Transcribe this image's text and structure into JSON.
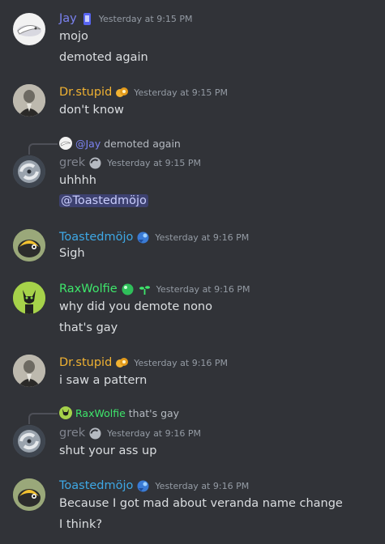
{
  "messages": [
    {
      "user": "Jay",
      "color": "#7b82f0",
      "time": "Yesterday at 9:15 PM",
      "lines": [
        "mojo",
        "demoted again"
      ]
    },
    {
      "user": "Dr.stupid",
      "color": "#f0b232",
      "time": "Yesterday at 9:15 PM",
      "lines": [
        "don't know"
      ]
    },
    {
      "user": "grek",
      "color": "#80848e",
      "time": "Yesterday at 9:15 PM",
      "reply_user": "@Jay",
      "reply_text": "demoted again",
      "reply_color": "#7b82f0",
      "lines": [
        "uhhhh"
      ],
      "mention": "@Toastedmöjo"
    },
    {
      "user": "Toastedmöjo",
      "color": "#3ea8e5",
      "time": "Yesterday at 9:16 PM",
      "lines": [
        "Sigh"
      ]
    },
    {
      "user": "RaxWolfie",
      "color": "#3ee66b",
      "time": "Yesterday at 9:16 PM",
      "lines": [
        "why did you demote nono",
        "that's gay"
      ]
    },
    {
      "user": "Dr.stupid",
      "color": "#f0b232",
      "time": "Yesterday at 9:16 PM",
      "lines": [
        "i saw a pattern"
      ]
    },
    {
      "user": "grek",
      "color": "#80848e",
      "time": "Yesterday at 9:16 PM",
      "reply_user": "RaxWolfie",
      "reply_text": "that's gay",
      "reply_color": "#3ee66b",
      "lines": [
        "shut your ass up"
      ]
    },
    {
      "user": "Toastedmöjo",
      "color": "#3ea8e5",
      "time": "Yesterday at 9:16 PM",
      "lines": [
        "Because I got mad about veranda name change",
        "I think?"
      ]
    }
  ],
  "icons": {
    "jay_avatar": "white-dragon-avatar",
    "drstupid_avatar": "vintage-portrait-avatar",
    "grek_avatar": "hurricane-avatar",
    "toasted_avatar": "yellow-bird-avatar",
    "rax_avatar": "green-wolf-avatar"
  }
}
